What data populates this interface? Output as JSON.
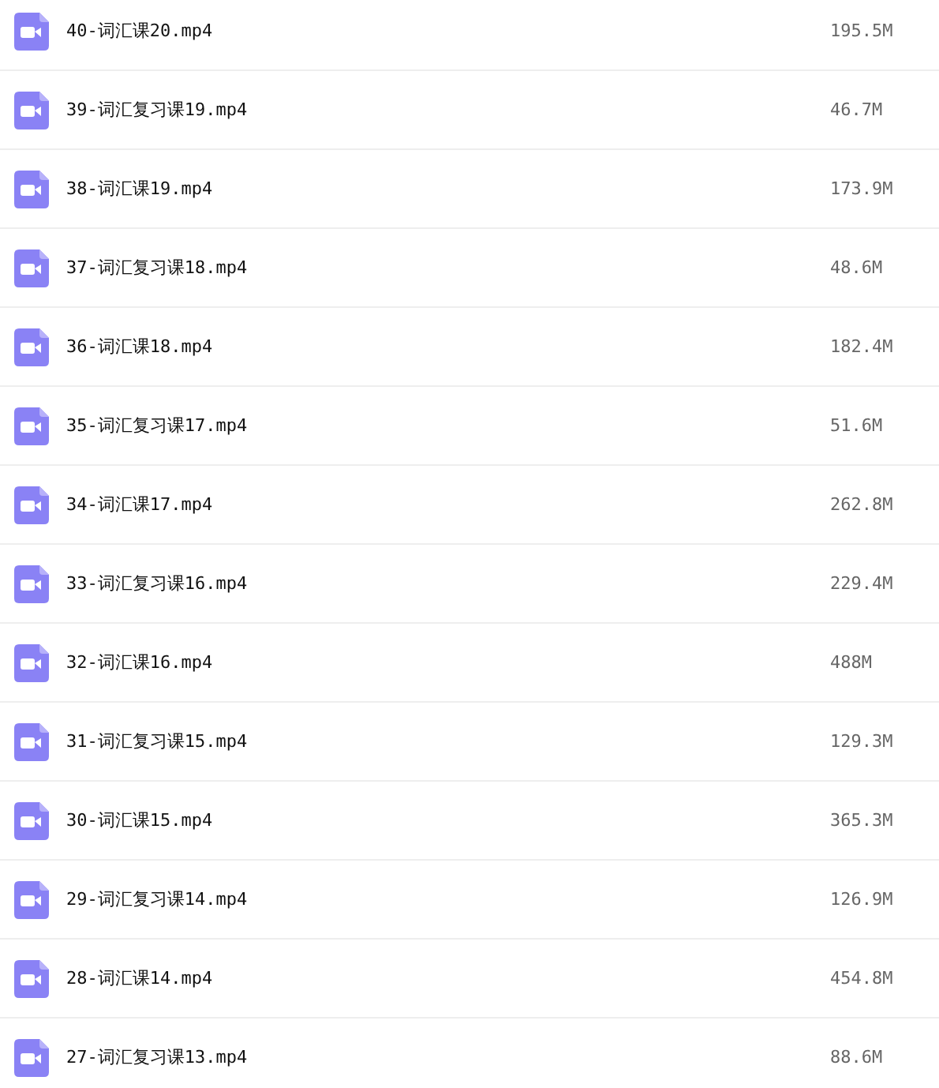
{
  "files": [
    {
      "name": "40-词汇课20.mp4",
      "size": "195.5M"
    },
    {
      "name": "39-词汇复习课19.mp4",
      "size": "46.7M"
    },
    {
      "name": "38-词汇课19.mp4",
      "size": "173.9M"
    },
    {
      "name": "37-词汇复习课18.mp4",
      "size": "48.6M"
    },
    {
      "name": "36-词汇课18.mp4",
      "size": "182.4M"
    },
    {
      "name": "35-词汇复习课17.mp4",
      "size": "51.6M"
    },
    {
      "name": "34-词汇课17.mp4",
      "size": "262.8M"
    },
    {
      "name": "33-词汇复习课16.mp4",
      "size": "229.4M"
    },
    {
      "name": "32-词汇课16.mp4",
      "size": "488M"
    },
    {
      "name": "31-词汇复习课15.mp4",
      "size": "129.3M"
    },
    {
      "name": "30-词汇课15.mp4",
      "size": "365.3M"
    },
    {
      "name": "29-词汇复习课14.mp4",
      "size": "126.9M"
    },
    {
      "name": "28-词汇课14.mp4",
      "size": "454.8M"
    },
    {
      "name": "27-词汇复习课13.mp4",
      "size": "88.6M"
    }
  ]
}
